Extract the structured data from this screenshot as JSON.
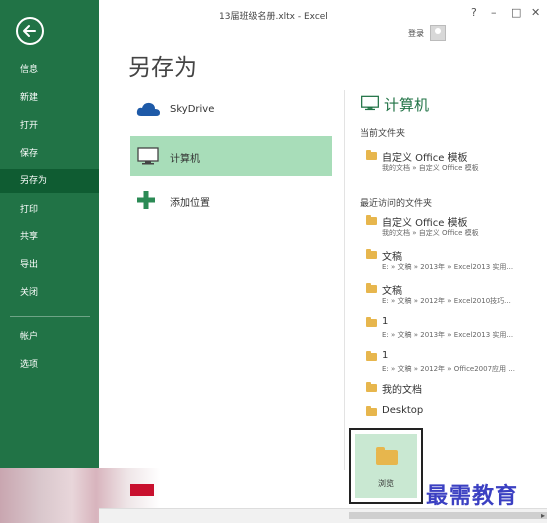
{
  "window": {
    "title": "13届班级名册.xltx - Excel",
    "controls": [
      "?",
      "–",
      "□",
      "✕"
    ],
    "signin": "登录"
  },
  "nav": {
    "items": [
      {
        "label": "信息"
      },
      {
        "label": "新建"
      },
      {
        "label": "打开"
      },
      {
        "label": "保存"
      },
      {
        "label": "另存为"
      },
      {
        "label": "打印"
      },
      {
        "label": "共享"
      },
      {
        "label": "导出"
      },
      {
        "label": "关闭"
      },
      {
        "label": "帐户"
      },
      {
        "label": "选项"
      }
    ],
    "active": "另存为"
  },
  "page": {
    "title": "另存为"
  },
  "locations": [
    {
      "label": "SkyDrive",
      "icon": "cloud-icon"
    },
    {
      "label": "计算机",
      "icon": "computer-icon",
      "selected": true
    },
    {
      "label": "添加位置",
      "icon": "plus-icon"
    }
  ],
  "right": {
    "title": "计算机",
    "current_heading": "当前文件夹",
    "current_folder": {
      "name": "自定义 Office 模板",
      "path": "我的文档 » 自定义 Office 模板"
    },
    "recent_heading": "最近访问的文件夹",
    "recent_folders": [
      {
        "name": "自定义 Office 模板",
        "path": "我的文档 » 自定义 Office 模板"
      },
      {
        "name": "文稿",
        "path": "E: » 文稿 » 2013年 » Excel2013 实用..."
      },
      {
        "name": "文稿",
        "path": "E: » 文稿 » 2012年 » Excel2010技巧..."
      },
      {
        "name": "1",
        "path": "E: » 文稿 » 2013年 » Excel2013 实用..."
      },
      {
        "name": "1",
        "path": "E: » 文稿 » 2012年 » Office2007应用 ..."
      },
      {
        "name": "我的文档",
        "path": ""
      },
      {
        "name": "Desktop",
        "path": ""
      }
    ],
    "browse_label": "浏览"
  },
  "watermark": "最需教育",
  "colors": {
    "nav_bg": "#217346",
    "nav_active": "#0f5c32",
    "selected_location": "#a8ddb9",
    "browse_bg": "#c9e8d2",
    "accent": "#217346",
    "folder": "#e7b64d"
  }
}
